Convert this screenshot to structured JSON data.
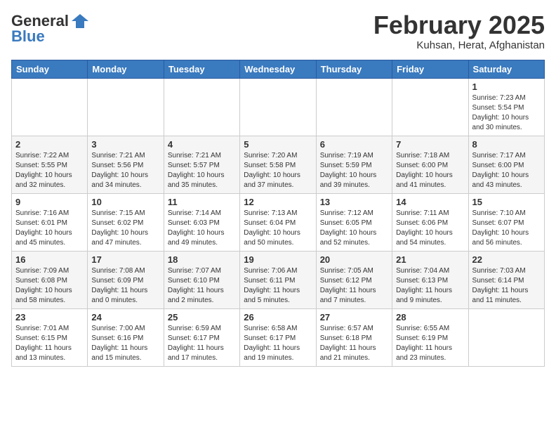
{
  "header": {
    "logo_line1": "General",
    "logo_line2": "Blue",
    "month": "February 2025",
    "location": "Kuhsan, Herat, Afghanistan"
  },
  "weekdays": [
    "Sunday",
    "Monday",
    "Tuesday",
    "Wednesday",
    "Thursday",
    "Friday",
    "Saturday"
  ],
  "weeks": [
    [
      {
        "day": "",
        "info": ""
      },
      {
        "day": "",
        "info": ""
      },
      {
        "day": "",
        "info": ""
      },
      {
        "day": "",
        "info": ""
      },
      {
        "day": "",
        "info": ""
      },
      {
        "day": "",
        "info": ""
      },
      {
        "day": "1",
        "info": "Sunrise: 7:23 AM\nSunset: 5:54 PM\nDaylight: 10 hours\nand 30 minutes."
      }
    ],
    [
      {
        "day": "2",
        "info": "Sunrise: 7:22 AM\nSunset: 5:55 PM\nDaylight: 10 hours\nand 32 minutes."
      },
      {
        "day": "3",
        "info": "Sunrise: 7:21 AM\nSunset: 5:56 PM\nDaylight: 10 hours\nand 34 minutes."
      },
      {
        "day": "4",
        "info": "Sunrise: 7:21 AM\nSunset: 5:57 PM\nDaylight: 10 hours\nand 35 minutes."
      },
      {
        "day": "5",
        "info": "Sunrise: 7:20 AM\nSunset: 5:58 PM\nDaylight: 10 hours\nand 37 minutes."
      },
      {
        "day": "6",
        "info": "Sunrise: 7:19 AM\nSunset: 5:59 PM\nDaylight: 10 hours\nand 39 minutes."
      },
      {
        "day": "7",
        "info": "Sunrise: 7:18 AM\nSunset: 6:00 PM\nDaylight: 10 hours\nand 41 minutes."
      },
      {
        "day": "8",
        "info": "Sunrise: 7:17 AM\nSunset: 6:00 PM\nDaylight: 10 hours\nand 43 minutes."
      }
    ],
    [
      {
        "day": "9",
        "info": "Sunrise: 7:16 AM\nSunset: 6:01 PM\nDaylight: 10 hours\nand 45 minutes."
      },
      {
        "day": "10",
        "info": "Sunrise: 7:15 AM\nSunset: 6:02 PM\nDaylight: 10 hours\nand 47 minutes."
      },
      {
        "day": "11",
        "info": "Sunrise: 7:14 AM\nSunset: 6:03 PM\nDaylight: 10 hours\nand 49 minutes."
      },
      {
        "day": "12",
        "info": "Sunrise: 7:13 AM\nSunset: 6:04 PM\nDaylight: 10 hours\nand 50 minutes."
      },
      {
        "day": "13",
        "info": "Sunrise: 7:12 AM\nSunset: 6:05 PM\nDaylight: 10 hours\nand 52 minutes."
      },
      {
        "day": "14",
        "info": "Sunrise: 7:11 AM\nSunset: 6:06 PM\nDaylight: 10 hours\nand 54 minutes."
      },
      {
        "day": "15",
        "info": "Sunrise: 7:10 AM\nSunset: 6:07 PM\nDaylight: 10 hours\nand 56 minutes."
      }
    ],
    [
      {
        "day": "16",
        "info": "Sunrise: 7:09 AM\nSunset: 6:08 PM\nDaylight: 10 hours\nand 58 minutes."
      },
      {
        "day": "17",
        "info": "Sunrise: 7:08 AM\nSunset: 6:09 PM\nDaylight: 11 hours\nand 0 minutes."
      },
      {
        "day": "18",
        "info": "Sunrise: 7:07 AM\nSunset: 6:10 PM\nDaylight: 11 hours\nand 2 minutes."
      },
      {
        "day": "19",
        "info": "Sunrise: 7:06 AM\nSunset: 6:11 PM\nDaylight: 11 hours\nand 5 minutes."
      },
      {
        "day": "20",
        "info": "Sunrise: 7:05 AM\nSunset: 6:12 PM\nDaylight: 11 hours\nand 7 minutes."
      },
      {
        "day": "21",
        "info": "Sunrise: 7:04 AM\nSunset: 6:13 PM\nDaylight: 11 hours\nand 9 minutes."
      },
      {
        "day": "22",
        "info": "Sunrise: 7:03 AM\nSunset: 6:14 PM\nDaylight: 11 hours\nand 11 minutes."
      }
    ],
    [
      {
        "day": "23",
        "info": "Sunrise: 7:01 AM\nSunset: 6:15 PM\nDaylight: 11 hours\nand 13 minutes."
      },
      {
        "day": "24",
        "info": "Sunrise: 7:00 AM\nSunset: 6:16 PM\nDaylight: 11 hours\nand 15 minutes."
      },
      {
        "day": "25",
        "info": "Sunrise: 6:59 AM\nSunset: 6:17 PM\nDaylight: 11 hours\nand 17 minutes."
      },
      {
        "day": "26",
        "info": "Sunrise: 6:58 AM\nSunset: 6:17 PM\nDaylight: 11 hours\nand 19 minutes."
      },
      {
        "day": "27",
        "info": "Sunrise: 6:57 AM\nSunset: 6:18 PM\nDaylight: 11 hours\nand 21 minutes."
      },
      {
        "day": "28",
        "info": "Sunrise: 6:55 AM\nSunset: 6:19 PM\nDaylight: 11 hours\nand 23 minutes."
      },
      {
        "day": "",
        "info": ""
      }
    ]
  ]
}
